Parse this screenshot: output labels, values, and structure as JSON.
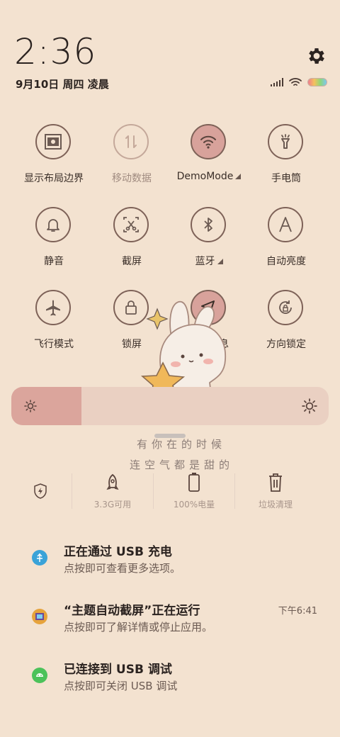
{
  "header": {
    "time": "2:36",
    "date": "9月10日 周四 凌晨"
  },
  "tiles": [
    {
      "label": "显示布局边界",
      "icon": "layout-bounds-icon",
      "state": "off"
    },
    {
      "label": "移动数据",
      "icon": "mobile-data-icon",
      "state": "disabled"
    },
    {
      "label": "DemoMode",
      "icon": "wifi-icon",
      "state": "on",
      "expandable": true
    },
    {
      "label": "手电筒",
      "icon": "flashlight-icon",
      "state": "off"
    },
    {
      "label": "静音",
      "icon": "bell-icon",
      "state": "off"
    },
    {
      "label": "截屏",
      "icon": "screenshot-icon",
      "state": "off"
    },
    {
      "label": "蓝牙",
      "icon": "bluetooth-icon",
      "state": "off",
      "expandable": true
    },
    {
      "label": "自动亮度",
      "icon": "auto-brightness-icon",
      "state": "off"
    },
    {
      "label": "飞行模式",
      "icon": "airplane-icon",
      "state": "off"
    },
    {
      "label": "锁屏",
      "icon": "lock-icon",
      "state": "off"
    },
    {
      "label": "位置信息",
      "icon": "location-icon",
      "state": "on"
    },
    {
      "label": "方向锁定",
      "icon": "rotation-lock-icon",
      "state": "off"
    }
  ],
  "brightness": {
    "level": 0.22
  },
  "decoration": {
    "line1": "有你在的时候",
    "line2": "连空气都是甜的"
  },
  "tools": [
    {
      "label": "",
      "icon": "power-saving-icon"
    },
    {
      "label": "3.3G可用",
      "icon": "rocket-icon"
    },
    {
      "label": "100%电量",
      "icon": "battery-icon"
    },
    {
      "label": "垃圾清理",
      "icon": "trash-icon"
    }
  ],
  "notifications": [
    {
      "title": "正在通过 USB 充电",
      "subtitle": "点按即可查看更多选项。",
      "time": "",
      "icon_color": "#3aa3d8"
    },
    {
      "title": "“主题自动截屏”正在运行",
      "subtitle": "点按即可了解详情或停止应用。",
      "time": "下午6:41",
      "icon_color": "#e6a33c"
    },
    {
      "title": "已连接到 USB 调试",
      "subtitle": "点按即可关闭 USB 调试",
      "time": "",
      "icon_color": "#4cc25a"
    }
  ],
  "colors": {
    "background": "#f3e2d0",
    "active": "#d8a29b",
    "outline": "#7e6258"
  }
}
